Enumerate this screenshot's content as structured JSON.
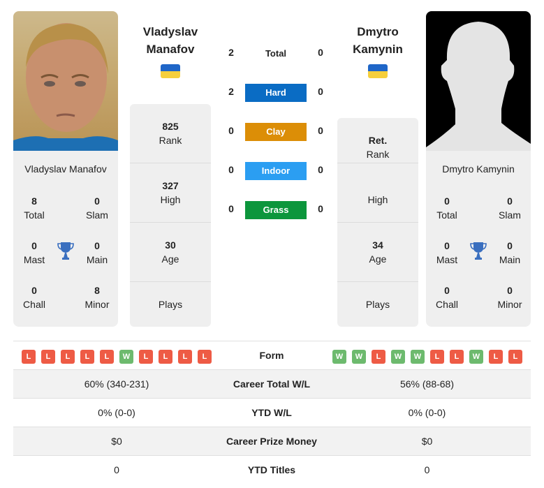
{
  "players": {
    "left": {
      "name": "Vladyslav Manafov",
      "name_line1": "Vladyslav",
      "name_line2": "Manafov",
      "flag": "ukraine-flag",
      "titles": {
        "total": {
          "value": "8",
          "label": "Total"
        },
        "slam": {
          "value": "0",
          "label": "Slam"
        },
        "mast": {
          "value": "0",
          "label": "Mast"
        },
        "main": {
          "value": "0",
          "label": "Main"
        },
        "chall": {
          "value": "0",
          "label": "Chall"
        },
        "minor": {
          "value": "8",
          "label": "Minor"
        }
      },
      "info": {
        "rank": {
          "value": "825",
          "label": "Rank"
        },
        "high": {
          "value": "327",
          "label": "High"
        },
        "age": {
          "value": "30",
          "label": "Age"
        },
        "plays": {
          "value": "",
          "label": "Plays"
        }
      }
    },
    "right": {
      "name": "Dmytro Kamynin",
      "name_line1": "Dmytro",
      "name_line2": "Kamynin",
      "flag": "ukraine-flag",
      "titles": {
        "total": {
          "value": "0",
          "label": "Total"
        },
        "slam": {
          "value": "0",
          "label": "Slam"
        },
        "mast": {
          "value": "0",
          "label": "Mast"
        },
        "main": {
          "value": "0",
          "label": "Main"
        },
        "chall": {
          "value": "0",
          "label": "Chall"
        },
        "minor": {
          "value": "0",
          "label": "Minor"
        }
      },
      "info": {
        "rank": {
          "value": "Ret.",
          "label": "Rank"
        },
        "high": {
          "value": "",
          "label": "High"
        },
        "age": {
          "value": "34",
          "label": "Age"
        },
        "plays": {
          "value": "",
          "label": "Plays"
        }
      }
    }
  },
  "h2h": {
    "total": {
      "label": "Total",
      "left": "2",
      "right": "0"
    },
    "surfaces": [
      {
        "label": "Hard",
        "left": "2",
        "right": "0",
        "color": "#0a6cc4"
      },
      {
        "label": "Clay",
        "left": "0",
        "right": "0",
        "color": "#dc8e07"
      },
      {
        "label": "Indoor",
        "left": "0",
        "right": "0",
        "color": "#2b9ef2"
      },
      {
        "label": "Grass",
        "left": "0",
        "right": "0",
        "color": "#0c963c"
      }
    ]
  },
  "comparison": {
    "form": {
      "label": "Form",
      "left": [
        "L",
        "L",
        "L",
        "L",
        "L",
        "W",
        "L",
        "L",
        "L",
        "L"
      ],
      "right": [
        "W",
        "W",
        "L",
        "W",
        "W",
        "L",
        "L",
        "W",
        "L",
        "L"
      ]
    },
    "rows": [
      {
        "label": "Career Total W/L",
        "left": "60% (340-231)",
        "right": "56% (88-68)"
      },
      {
        "label": "YTD W/L",
        "left": "0% (0-0)",
        "right": "0% (0-0)"
      },
      {
        "label": "Career Prize Money",
        "left": "$0",
        "right": "$0"
      },
      {
        "label": "YTD Titles",
        "left": "0",
        "right": "0"
      }
    ]
  },
  "colors": {
    "win": "#6dba6e",
    "loss": "#ee5b45",
    "trophy": "#3a6fbf"
  }
}
